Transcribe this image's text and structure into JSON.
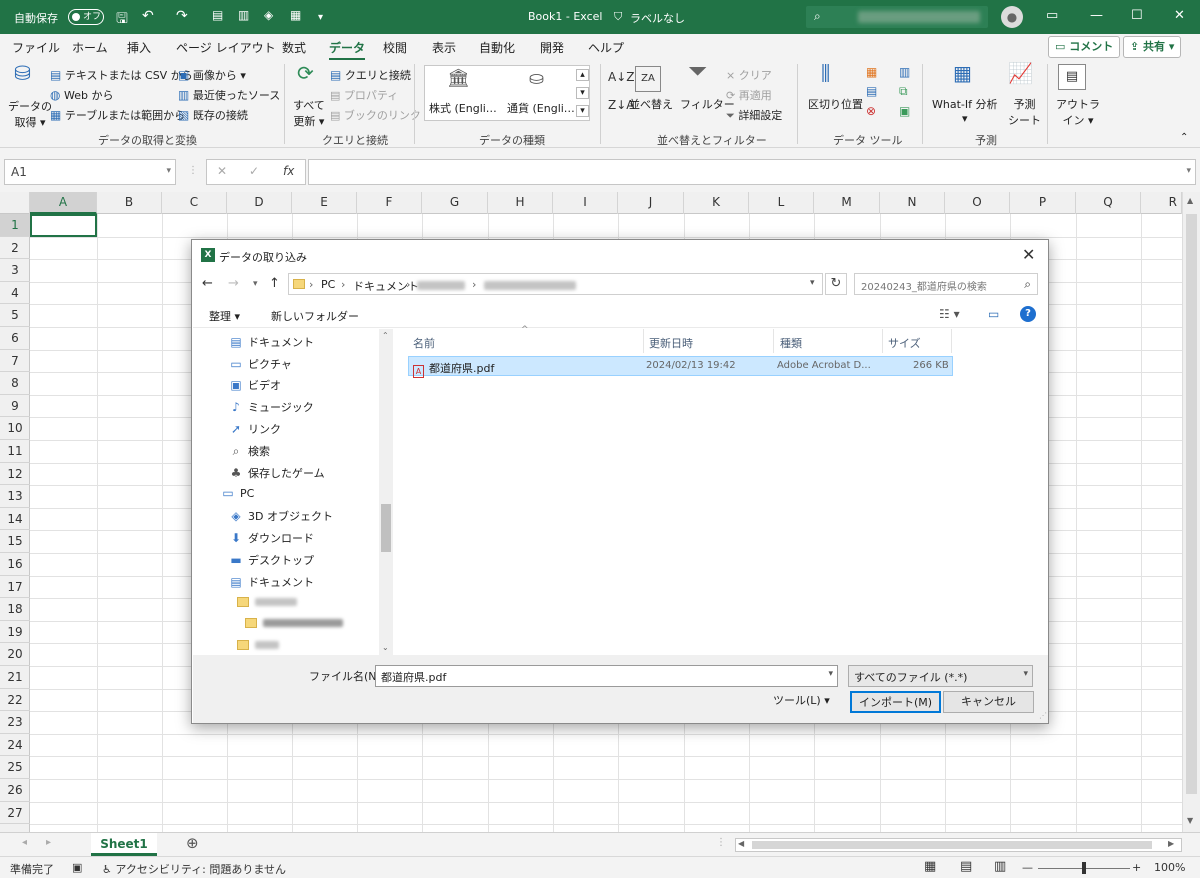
{
  "titlebar": {
    "autosave": "自動保存",
    "toggle": "オフ",
    "title": "Book1 - Excel",
    "label": "ラベルなし",
    "avatar_icon": "person-icon"
  },
  "menu": {
    "tabs": [
      "ファイル",
      "ホーム",
      "挿入",
      "ページ レイアウト",
      "数式",
      "データ",
      "校閲",
      "表示",
      "自動化",
      "開発",
      "ヘルプ"
    ],
    "active": "データ",
    "comment": "コメント",
    "share": "共有"
  },
  "ribbon": {
    "get_data": {
      "label1": "データの",
      "label2": "取得",
      "text_csv": "テキストまたは CSV から",
      "web": "Web から",
      "table": "テーブルまたは範囲から",
      "image": "画像から",
      "recent": "最近使ったソース",
      "existing": "既存の接続",
      "group": "データの取得と変換"
    },
    "queries": {
      "refresh1": "すべて",
      "refresh2": "更新",
      "queries_conn": "クエリと接続",
      "properties": "プロパティ",
      "edit_links": "ブックのリンク",
      "group": "クエリと接続"
    },
    "types": {
      "stocks": "株式 (Engli…",
      "currency": "通貨 (Engli…",
      "group": "データの種類"
    },
    "sort": {
      "sort": "並べ替え",
      "filter": "フィルター",
      "clear": "クリア",
      "reapply": "再適用",
      "advanced": "詳細設定",
      "group": "並べ替えとフィルター"
    },
    "tools": {
      "text_to_col": "区切り位置",
      "group": "データ ツール"
    },
    "forecast": {
      "whatif": "What-If 分析",
      "sheet1": "予測",
      "sheet2": "シート",
      "group": "予測"
    },
    "outline": {
      "l1": "アウトラ",
      "l2": "イン"
    }
  },
  "formula": {
    "namebox": "A1",
    "fx": "fx"
  },
  "grid": {
    "columns": [
      "A",
      "B",
      "C",
      "D",
      "E",
      "F",
      "G",
      "H",
      "I",
      "J",
      "K",
      "L",
      "M",
      "N",
      "O",
      "P",
      "Q",
      "R"
    ],
    "rows": [
      "1",
      "2",
      "3",
      "4",
      "5",
      "6",
      "7",
      "8",
      "9",
      "10",
      "11",
      "12",
      "13",
      "14",
      "15",
      "16",
      "17",
      "18",
      "19",
      "20",
      "21",
      "22",
      "23",
      "24",
      "25",
      "26",
      "27"
    ]
  },
  "sheets": {
    "tab": "Sheet1"
  },
  "status": {
    "ready": "準備完了",
    "accessibility": "アクセシビリティ: 問題ありません",
    "zoom": "100%"
  },
  "dialog": {
    "title": "データの取り込み",
    "path": [
      "PC",
      "ドキュメント"
    ],
    "search_placeholder": "20240243_都道府県の検索",
    "organize": "整理 ▾",
    "new_folder": "新しいフォルダー",
    "nav": [
      "ドキュメント",
      "ピクチャ",
      "ビデオ",
      "ミュージック",
      "リンク",
      "検索",
      "保存したゲーム",
      "PC",
      "3D オブジェクト",
      "ダウンロード",
      "デスクトップ",
      "ドキュメント"
    ],
    "nav_icons": [
      "document-icon",
      "picture-icon",
      "video-icon",
      "music-icon",
      "link-icon",
      "search-icon",
      "game-icon",
      "pc-icon",
      "cube-icon",
      "download-icon",
      "desktop-icon",
      "document-icon"
    ],
    "columns": {
      "name": "名前",
      "date": "更新日時",
      "type": "種類",
      "size": "サイズ"
    },
    "file": {
      "name": "都道府県.pdf",
      "date": "2024/02/13 19:42",
      "type": "Adobe Acrobat D...",
      "size": "266 KB"
    },
    "filename_label": "ファイル名(N):",
    "filename_value": "都道府県.pdf",
    "filetype": "すべてのファイル (*.*)",
    "tools": "ツール(L)",
    "import": "インポート(M)",
    "cancel": "キャンセル"
  }
}
